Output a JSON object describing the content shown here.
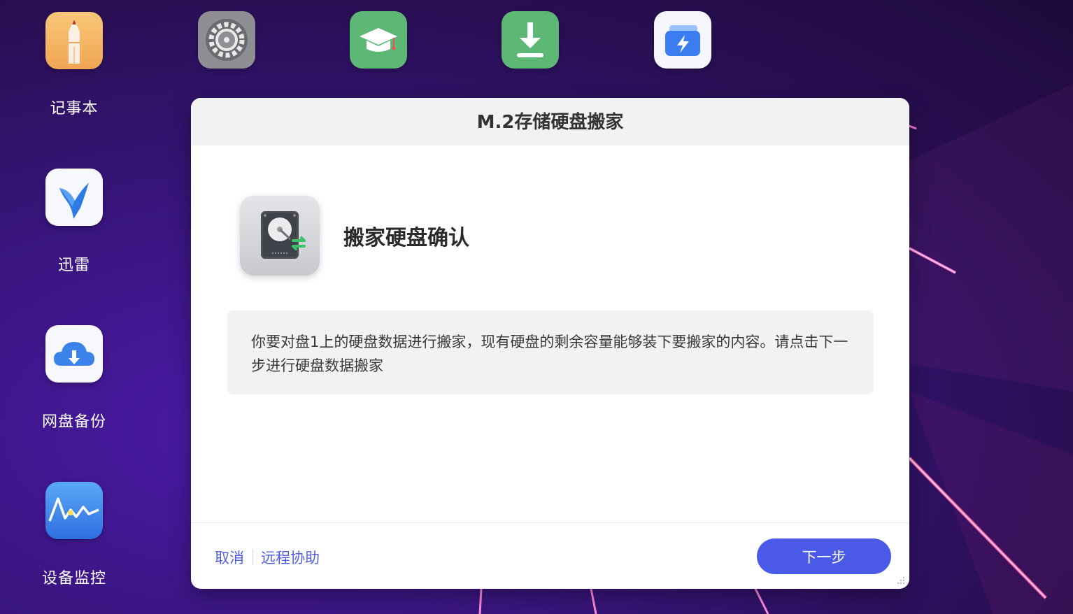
{
  "desktop": {
    "top_apps": [
      {
        "icon": "settings-gear-icon",
        "color": "#8e8e93"
      },
      {
        "icon": "graduation-cap-icon",
        "color": "#5cb874"
      },
      {
        "icon": "download-arrow-icon",
        "color": "#5cb874"
      },
      {
        "icon": "lightning-cards-icon",
        "color": "#3b7cf0"
      }
    ],
    "side_apps": [
      {
        "label": "记事本",
        "icon": "notepad-pencil-icon"
      },
      {
        "label": "迅雷",
        "icon": "thunder-bird-icon"
      },
      {
        "label": "网盘备份",
        "icon": "cloud-download-icon"
      },
      {
        "label": "设备监控",
        "icon": "pulse-monitor-icon"
      }
    ]
  },
  "dialog": {
    "title": "M.2存储硬盘搬家",
    "step_icon": "hard-drive-transfer-icon",
    "step_title": "搬家硬盘确认",
    "message": "你要对盘1上的硬盘数据进行搬家，现有硬盘的剩余容量能够装下要搬家的内容。请点击下一步进行硬盘数据搬家",
    "cancel_label": "取消",
    "remote_help_label": "远程协助",
    "next_label": "下一步",
    "accent_color": "#4b5ae6"
  }
}
